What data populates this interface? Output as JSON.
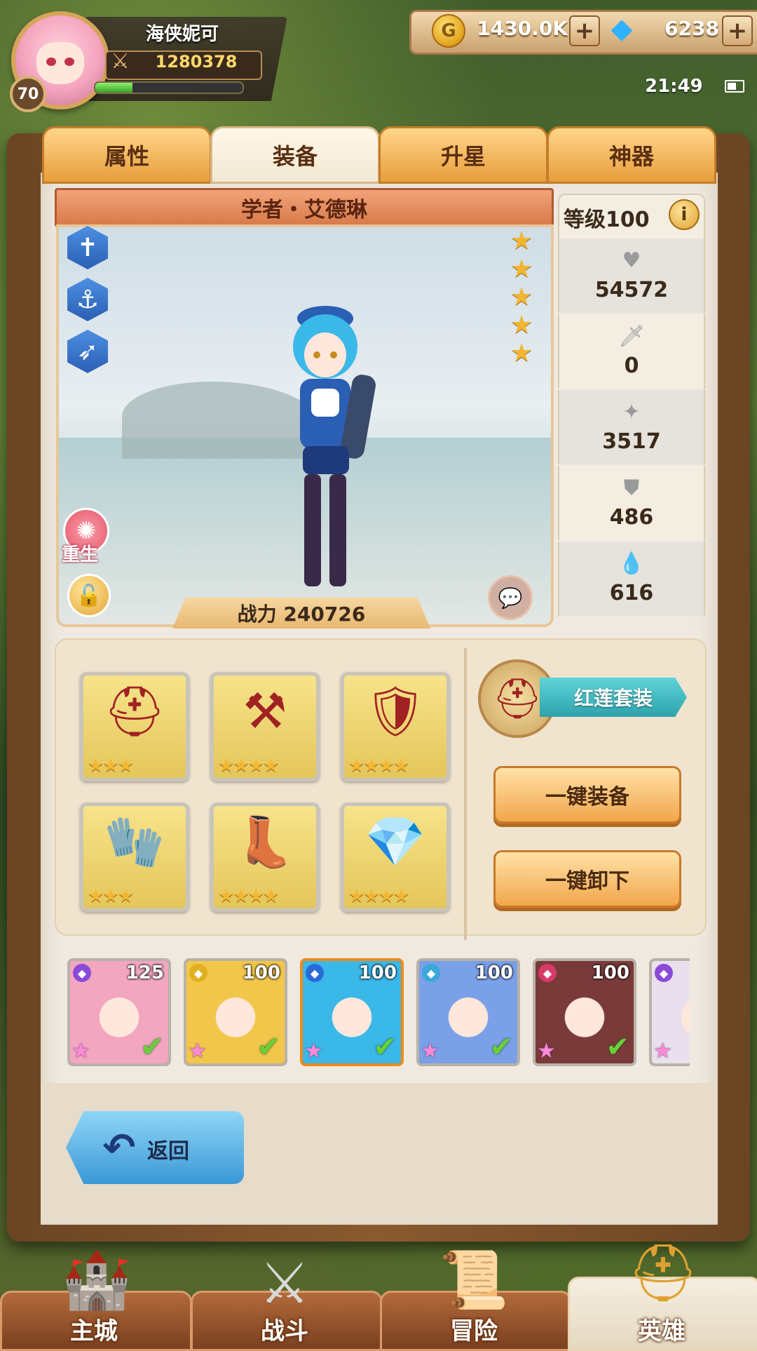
{
  "player": {
    "name": "海侠妮可",
    "level": "70",
    "power": "1280378",
    "xp_fraction": 0.25
  },
  "currency": {
    "gold": "1430.0K",
    "gems": "6238"
  },
  "status": {
    "time": "21:49"
  },
  "tabs": [
    {
      "label": "属性"
    },
    {
      "label": "装备"
    },
    {
      "label": "升星"
    },
    {
      "label": "神器"
    }
  ],
  "hero": {
    "title": "学者・艾德琳",
    "power_label": "战力 240726",
    "rebirth_label": "重生",
    "star_count": 5,
    "level_label": "等级100"
  },
  "stats": [
    {
      "icon": "heart-icon",
      "value": "54572"
    },
    {
      "icon": "sword-icon",
      "value": "0"
    },
    {
      "icon": "burst-icon",
      "value": "3517"
    },
    {
      "icon": "shield-icon",
      "value": "486"
    },
    {
      "icon": "drop-icon",
      "value": "616"
    }
  ],
  "equipment": [
    {
      "name": "helmet-icon",
      "stars": 3
    },
    {
      "name": "weapon-icon",
      "stars": 4
    },
    {
      "name": "armor-icon",
      "stars": 4
    },
    {
      "name": "gloves-icon",
      "stars": 3
    },
    {
      "name": "boots-icon",
      "stars": 4
    },
    {
      "name": "accessory-icon",
      "stars": 4
    }
  ],
  "equipment_set": {
    "label": "红莲套装"
  },
  "actions": {
    "equip_all": "一键装备",
    "unequip_all": "一键卸下"
  },
  "roster": [
    {
      "level": "125",
      "class_color": "#8a4ad8",
      "portrait_color": "#f2a6c0",
      "selected": false
    },
    {
      "level": "100",
      "class_color": "#e0b020",
      "portrait_color": "#f2c64a",
      "selected": false
    },
    {
      "level": "100",
      "class_color": "#2a6ad8",
      "portrait_color": "#3ab8e8",
      "selected": true
    },
    {
      "level": "100",
      "class_color": "#3aa8d8",
      "portrait_color": "#7aa0e8",
      "selected": false
    },
    {
      "level": "100",
      "class_color": "#d83a6a",
      "portrait_color": "#7a3a3a",
      "selected": false
    },
    {
      "level": "",
      "class_color": "#8a4ad8",
      "portrait_color": "#e8e0ec",
      "selected": false
    }
  ],
  "back": {
    "label": "返回"
  },
  "bottom_nav": [
    {
      "label": "主城",
      "active": false
    },
    {
      "label": "战斗",
      "active": false
    },
    {
      "label": "冒险",
      "active": false
    },
    {
      "label": "英雄",
      "active": true
    }
  ]
}
